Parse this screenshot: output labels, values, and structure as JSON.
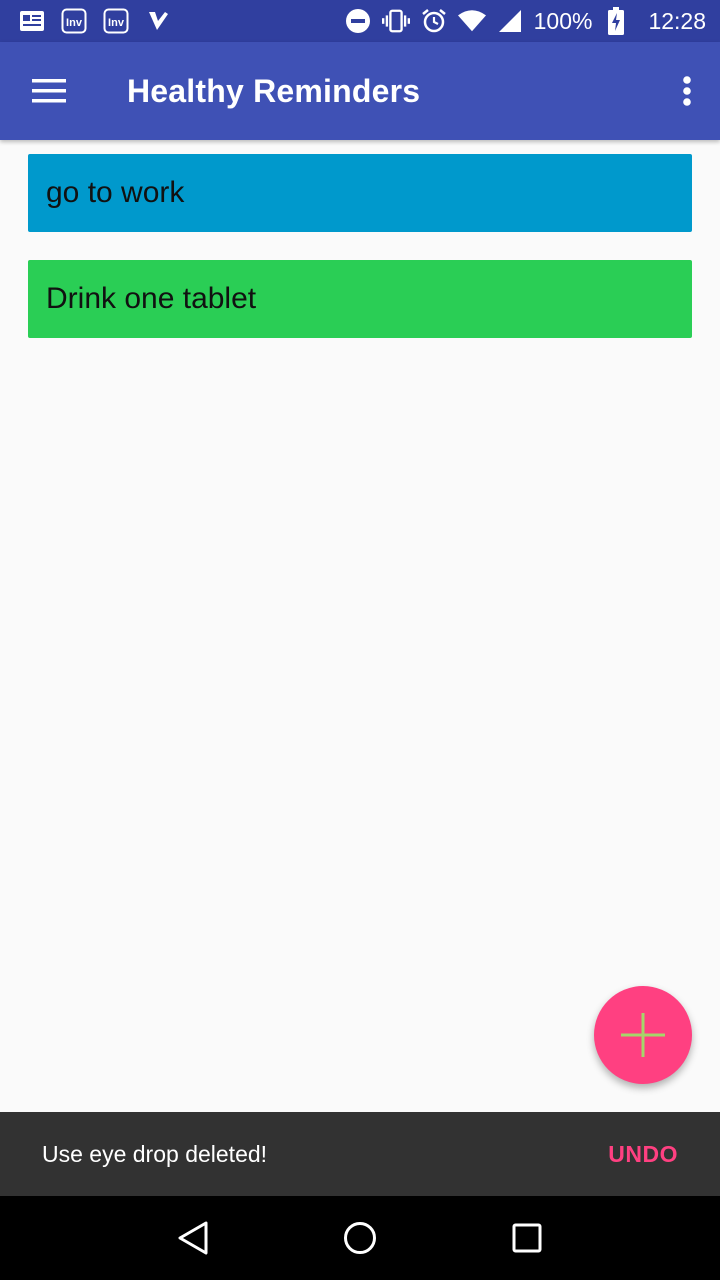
{
  "status_bar": {
    "battery": "100%",
    "time": "12:28",
    "icons": [
      "news-icon",
      "inv-icon",
      "inv-icon",
      "check-app-icon",
      "do-not-disturb-icon",
      "vibrate-icon",
      "alarm-icon",
      "wifi-icon",
      "cell-signal-icon",
      "battery-charging-icon"
    ]
  },
  "app_bar": {
    "title": "Healthy Reminders",
    "menu_icon": "hamburger-menu-icon",
    "overflow_icon": "more-vert-icon"
  },
  "reminders": [
    {
      "label": "go to work",
      "color": "#0099cc"
    },
    {
      "label": "Drink one tablet",
      "color": "#2ace55"
    }
  ],
  "fab": {
    "icon": "plus-icon",
    "color": "#ff4081",
    "icon_color": "#a5d66a"
  },
  "snackbar": {
    "message": "Use eye drop deleted!",
    "action": "UNDO",
    "action_color": "#ff4081"
  },
  "nav_bar": {
    "icons": [
      "back-icon",
      "home-icon",
      "recents-icon"
    ]
  },
  "colors": {
    "status_bar": "#303f9f",
    "app_bar": "#3f51b5",
    "background": "#fafafa",
    "snackbar": "#323232"
  }
}
